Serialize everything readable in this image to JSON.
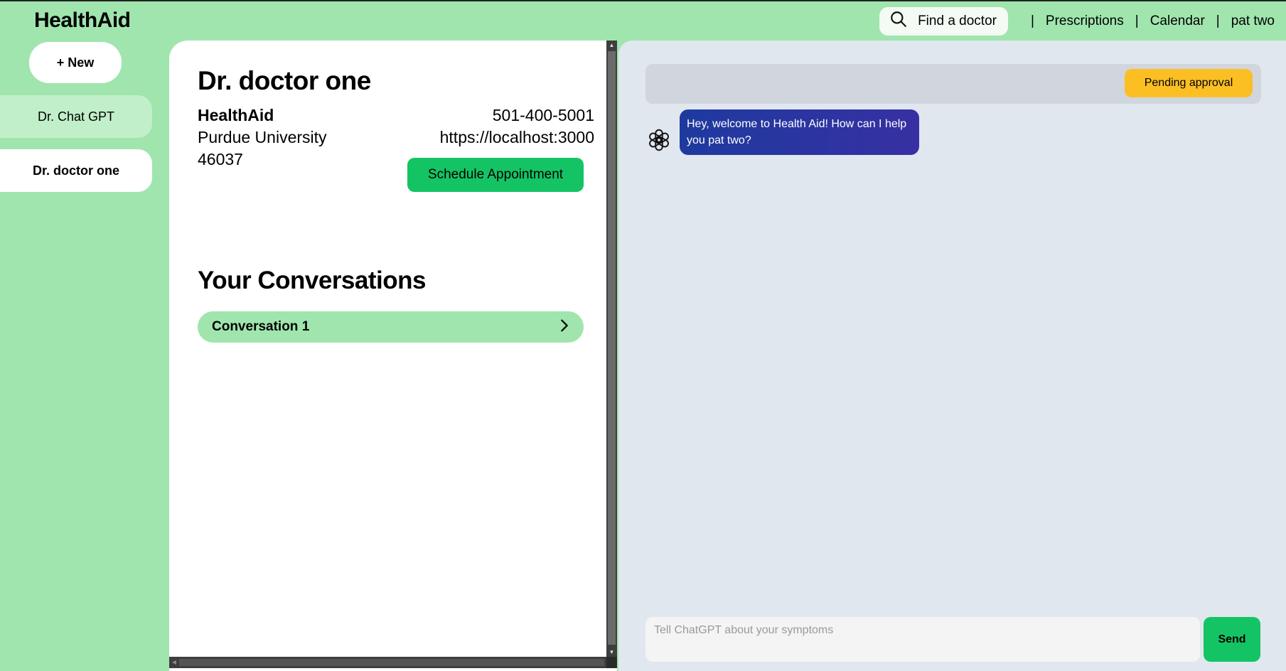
{
  "app": {
    "brand": "HealthAid"
  },
  "nav": {
    "find_doctor_label": "Find a doctor",
    "separator": "|",
    "prescriptions": "Prescriptions",
    "calendar": "Calendar",
    "user": "pat two"
  },
  "sidebar": {
    "new_label": "+ New",
    "items": [
      {
        "label": "Dr. Chat GPT",
        "selected": false
      },
      {
        "label": "Dr. doctor one",
        "selected": true
      }
    ]
  },
  "doctor": {
    "name": "Dr. doctor one",
    "organization": "HealthAid",
    "university": "Purdue University",
    "zip": "46037",
    "phone": "501-400-5001",
    "url": "https://localhost:3000",
    "schedule_label": "Schedule Appointment"
  },
  "conversations": {
    "title": "Your Conversations",
    "items": [
      {
        "label": "Conversation 1"
      }
    ]
  },
  "chat": {
    "status": "Pending approval",
    "messages": [
      {
        "sender": "bot",
        "avatar_icon": "chatgpt-logo-icon",
        "text": "Hey, welcome to Health Aid! How can I help you pat two?"
      }
    ],
    "input_placeholder": "Tell ChatGPT about your symptoms",
    "input_value": "",
    "send_label": "Send"
  },
  "colors": {
    "background": "#a0e5ae",
    "accent_green": "#14c464",
    "pending": "#fbbf24",
    "bubble_start": "#1e3a9f",
    "bubble_end": "#3730a3",
    "chat_bg": "#e1e7ef"
  }
}
